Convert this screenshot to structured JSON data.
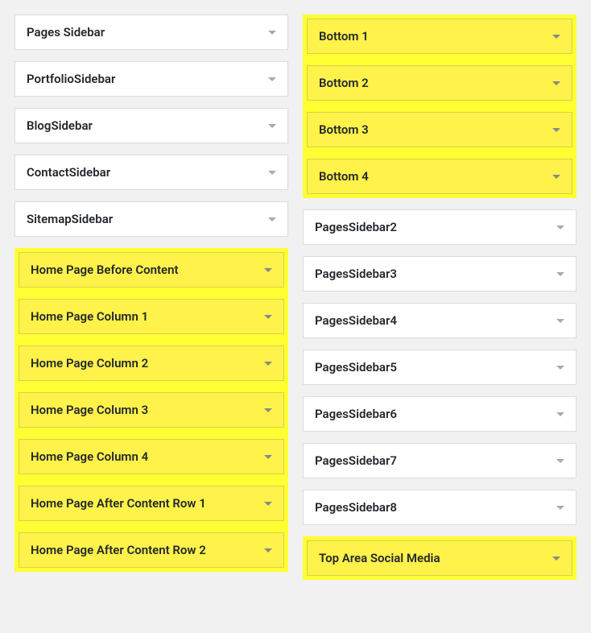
{
  "columns": {
    "left": {
      "plain_top": [
        "Pages Sidebar",
        "PortfolioSidebar",
        "BlogSidebar",
        "ContactSidebar",
        "SitemapSidebar"
      ],
      "highlighted": [
        "Home Page Before Content",
        "Home Page Column 1",
        "Home Page Column 2",
        "Home Page Column 3",
        "Home Page Column 4",
        "Home Page After Content Row 1",
        "Home Page After Content Row 2"
      ]
    },
    "right": {
      "highlighted_top": [
        "Bottom 1",
        "Bottom 2",
        "Bottom 3",
        "Bottom 4"
      ],
      "plain": [
        "PagesSidebar2",
        "PagesSidebar3",
        "PagesSidebar4",
        "PagesSidebar5",
        "PagesSidebar6",
        "PagesSidebar7",
        "PagesSidebar8"
      ],
      "highlighted_bottom": [
        "Top Area Social Media"
      ]
    }
  }
}
